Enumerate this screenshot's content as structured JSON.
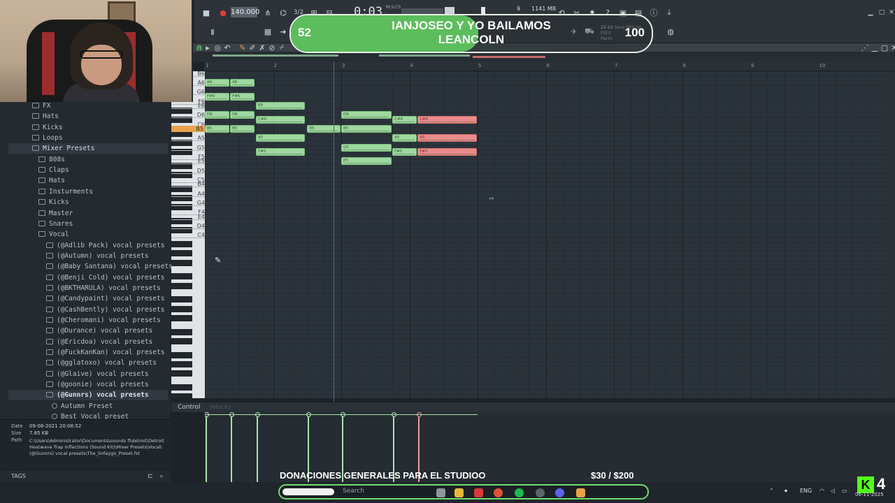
{
  "goal": {
    "current": "52",
    "target": "100",
    "progress": 0.52,
    "title_line1": "IANJOSEO Y YO BAILAMOS",
    "title_line2": "LEANCOLN"
  },
  "toolbar": {
    "tempo": "140.000",
    "clock": "0:03",
    "clock_sub": "M:S:CS",
    "cpu": "9",
    "memory": "1141 MB",
    "news_date": "23-10",
    "news_line1": "Save 50% on FLEX",
    "news_line2": "Packs"
  },
  "browser": {
    "items": [
      {
        "label": "FX",
        "level": 1
      },
      {
        "label": "Hats",
        "level": 1
      },
      {
        "label": "Kicks",
        "level": 1
      },
      {
        "label": "Loops",
        "level": 1
      },
      {
        "label": "Mixer Presets",
        "level": 1
      },
      {
        "label": "808s",
        "level": 2
      },
      {
        "label": "Claps",
        "level": 2
      },
      {
        "label": "Hats",
        "level": 2
      },
      {
        "label": "Insturments",
        "level": 2
      },
      {
        "label": "Kicks",
        "level": 2
      },
      {
        "label": "Master",
        "level": 2
      },
      {
        "label": "Snares",
        "level": 2
      },
      {
        "label": "Vocal",
        "level": 2
      },
      {
        "label": "(@Adlib Pack) vocal presets",
        "level": 3
      },
      {
        "label": "(@Autumn) vocal presets",
        "level": 3
      },
      {
        "label": "(@Baby Santana) vocal presets",
        "level": 3
      },
      {
        "label": "(@Benji Cold) vocal presets",
        "level": 3
      },
      {
        "label": "(@BKTHARULA) vocal presets",
        "level": 3
      },
      {
        "label": "(@Candypaint) vocal presets",
        "level": 3
      },
      {
        "label": "(@CashBently) vocal presets",
        "level": 3
      },
      {
        "label": "(@Cheromani) vocal presets",
        "level": 3
      },
      {
        "label": "(@Durance) vocal presets",
        "level": 3
      },
      {
        "label": "(@Ericdoa) vocal presets",
        "level": 3
      },
      {
        "label": "(@FuckKanKan) vocal presets",
        "level": 3
      },
      {
        "label": "(@gglatoxo) vocal presets",
        "level": 3
      },
      {
        "label": "(@Glaive) vocal presets",
        "level": 3
      },
      {
        "label": "(@goonie) vocal presets",
        "level": 3
      },
      {
        "label": "(@Gunnrs) vocal presets",
        "level": 3
      },
      {
        "label": "Autumn Preset",
        "level": 4
      },
      {
        "label": "Best_Vocal_preset",
        "level": 4
      }
    ]
  },
  "info": {
    "date_key": "Date",
    "date_val": "09-08-2021 20:08:52",
    "size_key": "Size",
    "size_val": "7.85 KB",
    "path_key": "Path",
    "path_val": "C:\\Users\\Administrator\\Documents\\sounds fl\\detroit\\Detroit Heatwave Trap Inflections (Sound Kit)\\Mixer Presets\\Vocal\\(@Gunnrs) vocal presets\\The_Sofaygo_Preset.fst",
    "tags": "TAGS"
  },
  "ruler": [
    "1",
    "2",
    "3",
    "4",
    "5",
    "6",
    "7",
    "8",
    "9",
    "10"
  ],
  "keys": [
    "B6",
    "A6",
    "G6",
    "F6",
    "E6",
    "D6",
    "C6",
    "B5",
    "A5",
    "G5",
    "F5",
    "E5",
    "D5",
    "C5",
    "B4",
    "A4",
    "G4",
    "F4",
    "E4",
    "D4",
    "C4"
  ],
  "notes": [
    {
      "label": "A6",
      "pitch": "A6",
      "start": 0,
      "len": 0.37,
      "color": "g"
    },
    {
      "label": "A6",
      "pitch": "A6",
      "start": 0.37,
      "len": 0.37,
      "color": "g"
    },
    {
      "label": "F#6",
      "pitch": "F#6",
      "start": 0,
      "len": 0.37,
      "color": "g"
    },
    {
      "label": "F#6",
      "pitch": "F#6",
      "start": 0.37,
      "len": 0.37,
      "color": "g"
    },
    {
      "label": "E6",
      "pitch": "E6",
      "start": 0.75,
      "len": 0.73,
      "color": "g"
    },
    {
      "label": "D6",
      "pitch": "D6",
      "start": 0,
      "len": 0.37,
      "color": "g"
    },
    {
      "label": "D6",
      "pitch": "D6",
      "start": 0.37,
      "len": 0.37,
      "color": "g"
    },
    {
      "label": "D6",
      "pitch": "D6",
      "start": 2,
      "len": 0.75,
      "color": "g"
    },
    {
      "label": "C#6",
      "pitch": "C#6",
      "start": 0.75,
      "len": 0.73,
      "color": "g"
    },
    {
      "label": "C#6",
      "pitch": "C#6",
      "start": 2.75,
      "len": 0.37,
      "color": "g"
    },
    {
      "label": "C#6",
      "pitch": "C#6",
      "start": 3.12,
      "len": 0.88,
      "color": "r"
    },
    {
      "label": "B5",
      "pitch": "B5",
      "start": 0,
      "len": 0.37,
      "color": "g"
    },
    {
      "label": "B5",
      "pitch": "B5",
      "start": 0.37,
      "len": 0.37,
      "color": "g"
    },
    {
      "label": "B5",
      "pitch": "B5",
      "start": 1.5,
      "len": 0.5,
      "color": "g"
    },
    {
      "label": "B5",
      "pitch": "B5",
      "start": 2,
      "len": 0.75,
      "color": "g"
    },
    {
      "label": "A5",
      "pitch": "A5",
      "start": 0.75,
      "len": 0.73,
      "color": "g"
    },
    {
      "label": "A5",
      "pitch": "A5",
      "start": 2.75,
      "len": 0.37,
      "color": "g"
    },
    {
      "label": "A5",
      "pitch": "A5",
      "start": 3.12,
      "len": 0.88,
      "color": "r"
    },
    {
      "label": "G5",
      "pitch": "G5",
      "start": 2,
      "len": 0.75,
      "color": "g"
    },
    {
      "label": "F#5",
      "pitch": "F#5",
      "start": 0.75,
      "len": 0.73,
      "color": "g"
    },
    {
      "label": "F#5",
      "pitch": "F#5",
      "start": 2.75,
      "len": 0.37,
      "color": "g"
    },
    {
      "label": "F#5",
      "pitch": "F#5",
      "start": 3.12,
      "len": 0.88,
      "color": "r"
    },
    {
      "label": "E5",
      "pitch": "E5",
      "start": 2,
      "len": 0.75,
      "color": "g"
    }
  ],
  "control": {
    "label": "Control",
    "sub": "Velocity"
  },
  "velocities": [
    {
      "pos": 0,
      "value": 1.0,
      "color": "g"
    },
    {
      "pos": 0.37,
      "value": 1.0,
      "color": "g"
    },
    {
      "pos": 0.75,
      "value": 1.0,
      "color": "g"
    },
    {
      "pos": 1.5,
      "value": 1.0,
      "color": "g"
    },
    {
      "pos": 2,
      "value": 1.0,
      "color": "g"
    },
    {
      "pos": 2.75,
      "value": 1.0,
      "color": "g"
    },
    {
      "pos": 3.12,
      "value": 1.0,
      "color": "r"
    }
  ],
  "donation": {
    "text": "DONACIONES GENERALES PARA EL STUDIOO",
    "amount": "$30  / $200"
  },
  "taskbar": {
    "search": "Search",
    "lang": "ENG",
    "date": "06-11-2025",
    "kick_count": "4",
    "kick_letter": "K"
  },
  "colors": {
    "note_green": "#9fd89f",
    "note_red": "#e98b8b",
    "goal_green": "#5cbd5c",
    "accent": "#e7a24b"
  }
}
